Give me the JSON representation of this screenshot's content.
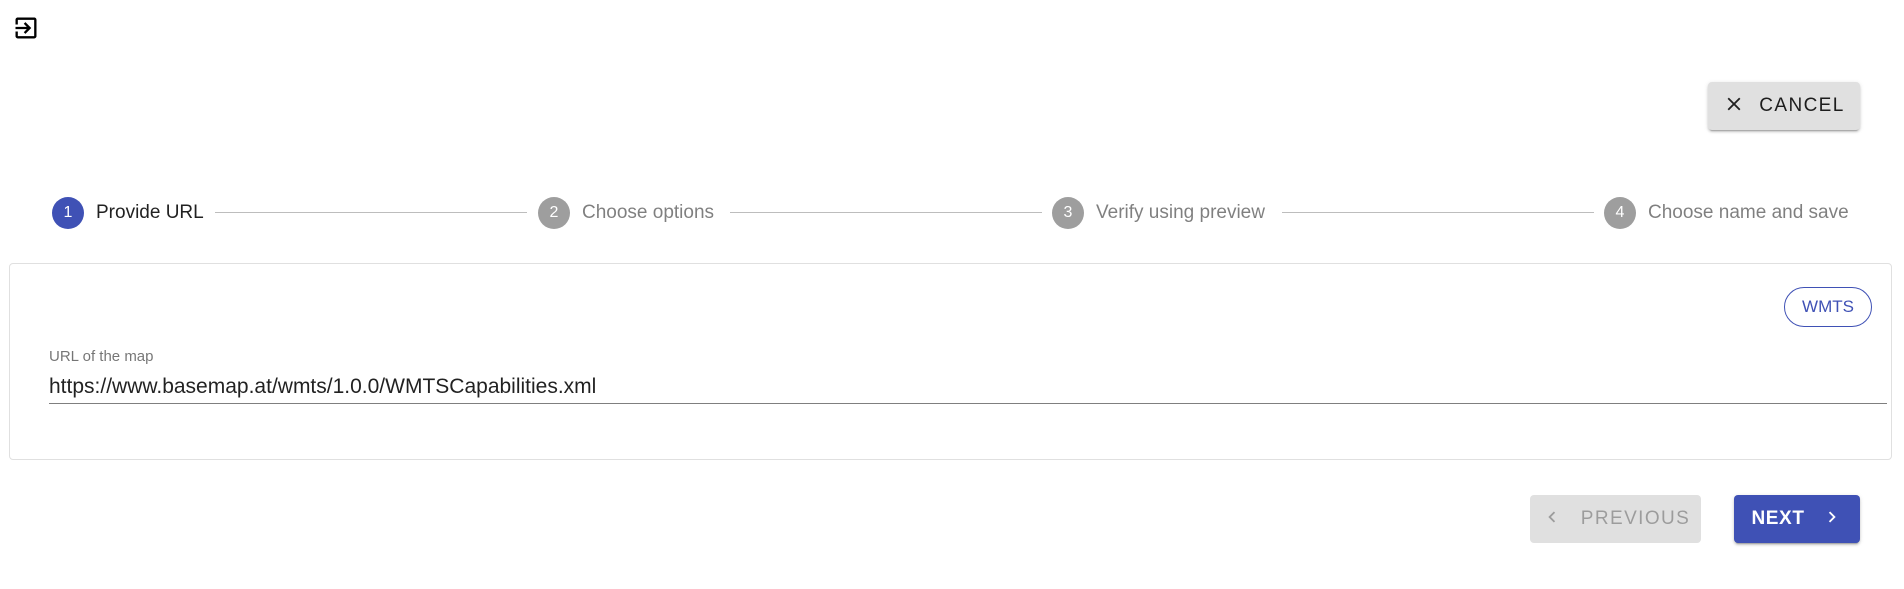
{
  "toolbar": {
    "exit_icon": "exit-to-app-icon"
  },
  "cancel": {
    "label": "CANCEL",
    "icon": "close-icon"
  },
  "stepper": {
    "steps": [
      {
        "number": "1",
        "label": "Provide URL",
        "active": true
      },
      {
        "number": "2",
        "label": "Choose options",
        "active": false
      },
      {
        "number": "3",
        "label": "Verify using preview",
        "active": false
      },
      {
        "number": "4",
        "label": "Choose name and save",
        "active": false
      }
    ]
  },
  "form": {
    "chip_label": "WMTS",
    "url_label": "URL of the map",
    "url_value": "https://www.basemap.at/wmts/1.0.0/WMTSCapabilities.xml"
  },
  "nav": {
    "previous_label": "PREVIOUS",
    "previous_icon": "chevron-left-icon",
    "next_label": "NEXT",
    "next_icon": "chevron-right-icon"
  },
  "colors": {
    "primary": "#3f51b5",
    "inactive_step": "#9e9e9e",
    "button_grey": "#e0e0e0"
  }
}
